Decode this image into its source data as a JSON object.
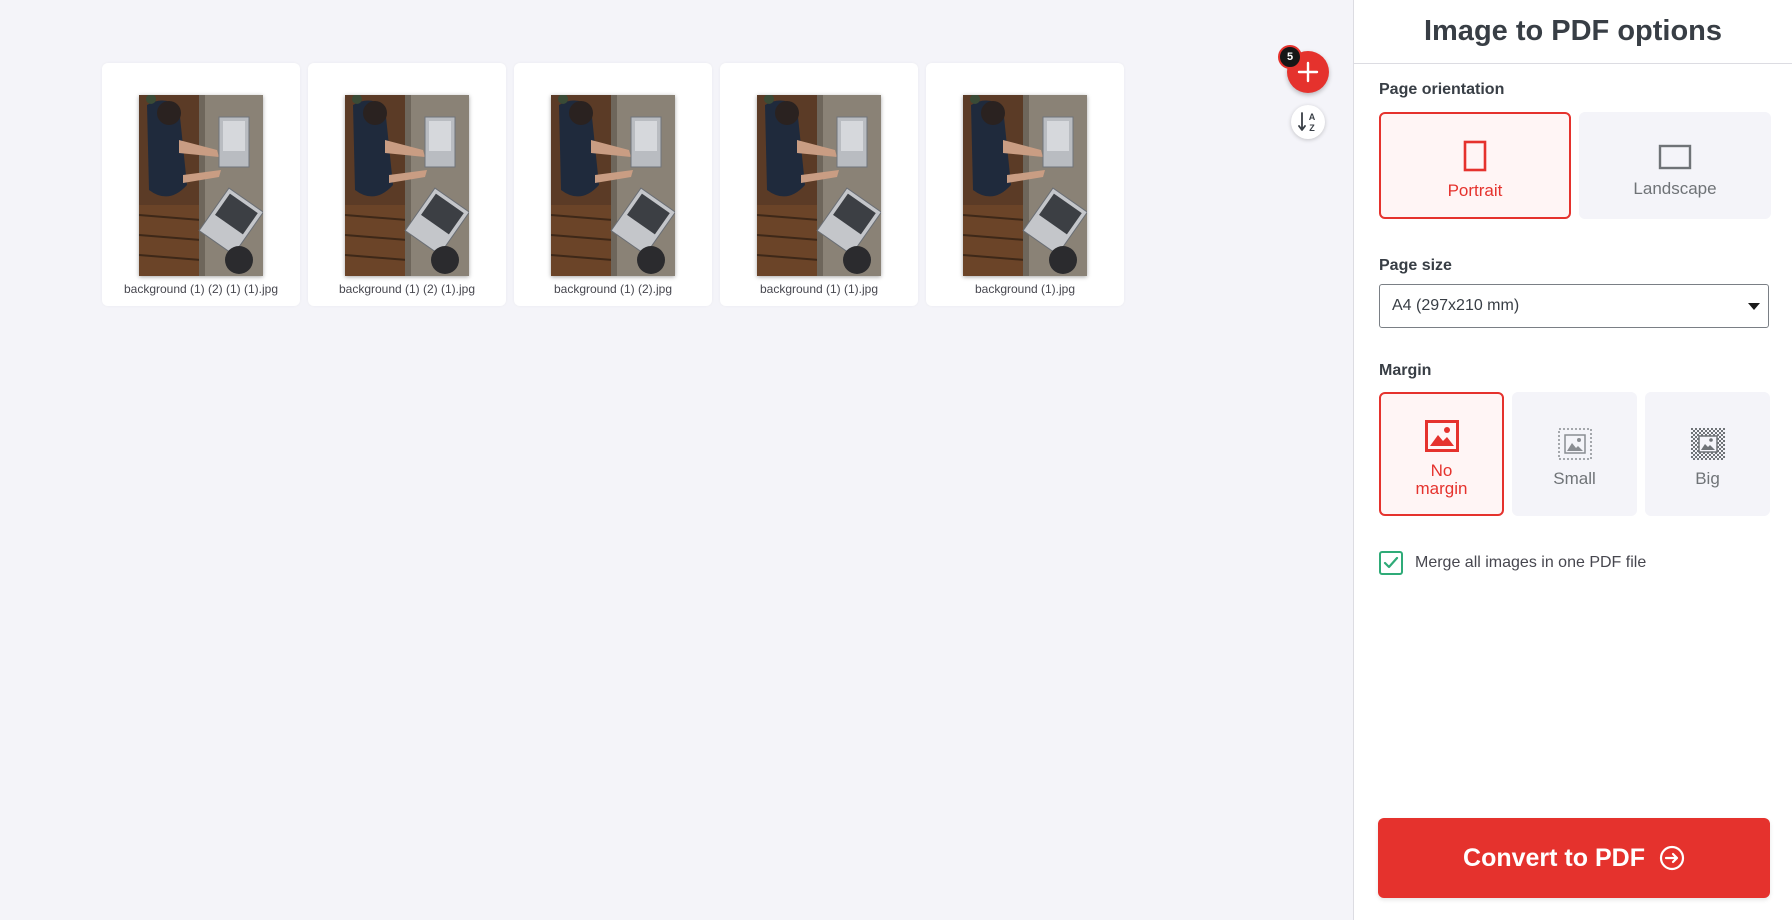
{
  "files": [
    {
      "name": "background (1) (2) (1) (1).jpg"
    },
    {
      "name": "background (1) (2) (1).jpg"
    },
    {
      "name": "background (1) (2).jpg"
    },
    {
      "name": "background (1) (1).jpg"
    },
    {
      "name": "background (1).jpg"
    }
  ],
  "toolbar": {
    "file_count": "5",
    "add_icon": "plus-icon",
    "sort_icon": "sort-alphabetical-icon"
  },
  "sidebar": {
    "title": "Image to PDF options",
    "orientation": {
      "label": "Page orientation",
      "options": [
        {
          "label": "Portrait",
          "icon": "portrait-page-icon",
          "selected": true
        },
        {
          "label": "Landscape",
          "icon": "landscape-page-icon",
          "selected": false
        }
      ]
    },
    "page_size": {
      "label": "Page size",
      "selected": "A4 (297x210 mm)"
    },
    "margin": {
      "label": "Margin",
      "options": [
        {
          "label": "No margin",
          "icon": "no-margin-image-icon",
          "selected": true
        },
        {
          "label": "Small",
          "icon": "small-margin-image-icon",
          "selected": false
        },
        {
          "label": "Big",
          "icon": "big-margin-image-icon",
          "selected": false
        }
      ]
    },
    "merge": {
      "label": "Merge all images in one PDF file",
      "checked": true
    },
    "convert_label": "Convert to PDF"
  },
  "colors": {
    "accent": "#e5322d",
    "check": "#2fab78",
    "background": "#f4f4f9"
  }
}
